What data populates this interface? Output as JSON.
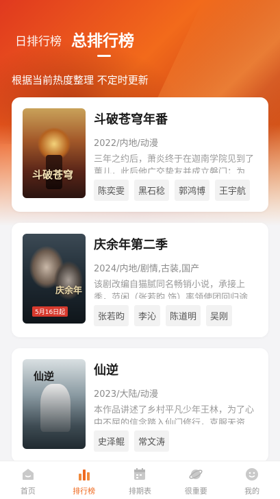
{
  "header": {
    "tab_day": "日排行榜",
    "tab_total": "总排行榜",
    "subtitle": "根据当前热度整理 不定时更新"
  },
  "items": [
    {
      "title": "斗破苍穹年番",
      "meta": "2022/内地/动漫",
      "desc": "三年之约后，萧炎终于在迦南学院见到了薰儿，此后他广交挚友并成立磐门；为…",
      "cast": [
        "陈奕雯",
        "黑石稔",
        "郭鸿博",
        "王宇航"
      ]
    },
    {
      "title": "庆余年第二季",
      "meta": "2024/内地/剧情,古装,国产",
      "desc": "该剧改编自猫腻同名畅销小说，承接上季，范闲（张若昀 饰）率领使团回归途 …",
      "cast": [
        "张若昀",
        "李沁",
        "陈道明",
        "吴刚"
      ],
      "poster_date": "5月16日起"
    },
    {
      "title": "仙逆",
      "meta": "2023/大陆/动漫",
      "desc": "本作品讲述了乡村平凡少年王林，为了心中不屈的信念踏入仙门修行，克服天资…",
      "cast": [
        "史泽鲲",
        "常文涛"
      ]
    }
  ],
  "tabbar": [
    {
      "label": "首页",
      "icon": "home-icon"
    },
    {
      "label": "排行榜",
      "icon": "bar-chart-icon",
      "active": true
    },
    {
      "label": "排期表",
      "icon": "calendar-icon"
    },
    {
      "label": "很重要",
      "icon": "planet-icon"
    },
    {
      "label": "我的",
      "icon": "smiley-icon"
    }
  ],
  "colors": {
    "accent": "#ef6a20",
    "hero": "#e0391f"
  }
}
